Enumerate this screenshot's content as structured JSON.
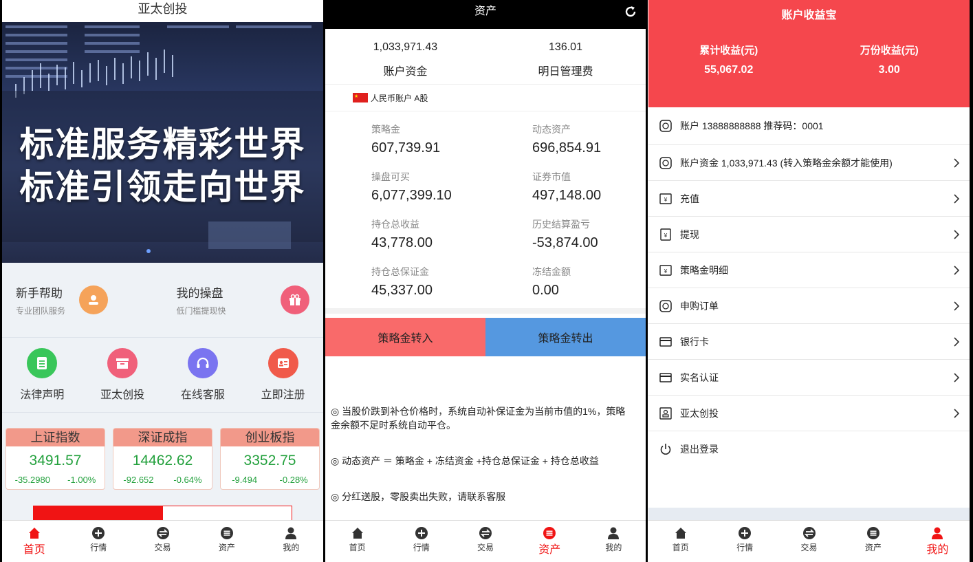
{
  "home": {
    "title": "亚太创投",
    "slogan_line1": "标准服务精彩世界",
    "slogan_line2": "标准引领走向世界",
    "help": [
      {
        "title": "新手帮助",
        "subtitle": "专业团队服务",
        "icon": "user-badge-icon",
        "color": "#f5a35a"
      },
      {
        "title": "我的操盘",
        "subtitle": "低门槛提现快",
        "icon": "gift-icon",
        "color": "#f0607a"
      }
    ],
    "quick": [
      {
        "label": "法律声明",
        "icon": "document-icon",
        "color": "#39c65a"
      },
      {
        "label": "亚太创投",
        "icon": "box-icon",
        "color": "#f0607a"
      },
      {
        "label": "在线客服",
        "icon": "headset-icon",
        "color": "#7a74f0"
      },
      {
        "label": "立即注册",
        "icon": "id-card-icon",
        "color": "#f05a4a"
      }
    ],
    "indices": [
      {
        "name": "上证指数",
        "value": "3491.57",
        "change": "-35.2980",
        "percent": "-1.00%"
      },
      {
        "name": "深证成指",
        "value": "14462.62",
        "change": "-92.652",
        "percent": "-0.64%"
      },
      {
        "name": "创业板指",
        "value": "3352.75",
        "change": "-9.494",
        "percent": "-0.28%"
      }
    ]
  },
  "assets": {
    "title": "资产",
    "account_funds_value": "1,033,971.43",
    "account_funds_label": "账户资金",
    "mgmt_fee_value": "136.01",
    "mgmt_fee_label": "明日管理费",
    "cny_account": "人民币账户 A股",
    "grid": [
      {
        "label": "策略金",
        "value": "607,739.91"
      },
      {
        "label": "动态资产",
        "value": "696,854.91"
      },
      {
        "label": "操盘可买",
        "value": "6,077,399.10"
      },
      {
        "label": "证券市值",
        "value": "497,148.00"
      },
      {
        "label": "持仓总收益",
        "value": "43,778.00"
      },
      {
        "label": "历史结算盈亏",
        "value": "-53,874.00"
      },
      {
        "label": "持仓总保证金",
        "value": "45,337.00"
      },
      {
        "label": "冻结金额",
        "value": "0.00"
      }
    ],
    "transfer_in": "策略金转入",
    "transfer_out": "策略金转出",
    "note1": "◎ 当股价跌到补仓价格时，系统自动补保证金为当前市值的1%，策略金余额不足时系统自动平仓。",
    "note2": "◎ 动态资产 ＝ 策略金 + 冻结资金 +持仓总保证金 + 持仓总收益",
    "note3": "◎ 分红送股，零股卖出失败，请联系客服"
  },
  "profile": {
    "title": "账户收益宝",
    "cum_label": "累计收益(元)",
    "cum_value": "55,067.02",
    "wan_label": "万份收益(元)",
    "wan_value": "3.00",
    "account_row": "账户  13888888888   推荐码：0001",
    "funds_row": "账户资金   1,033,971.43 (转入策略金余额才能使用)",
    "menu": [
      {
        "label": "充值",
        "icon": "recharge-icon"
      },
      {
        "label": "提现",
        "icon": "withdraw-icon"
      },
      {
        "label": "策略金明细",
        "icon": "ledger-icon"
      },
      {
        "label": "申购订单",
        "icon": "order-icon"
      },
      {
        "label": "银行卡",
        "icon": "bank-card-icon"
      },
      {
        "label": "实名认证",
        "icon": "id-verify-icon"
      },
      {
        "label": "亚太创投",
        "icon": "company-icon"
      }
    ],
    "logout": "退出登录"
  },
  "nav": {
    "home": "首页",
    "market": "行情",
    "trade": "交易",
    "assets": "资产",
    "mine": "我的"
  },
  "colors": {
    "accent_red": "#f01414",
    "up_green": "#22a03c",
    "header_red": "#f5474d",
    "transfer_in": "#f96a6a",
    "transfer_out": "#5598e0"
  }
}
